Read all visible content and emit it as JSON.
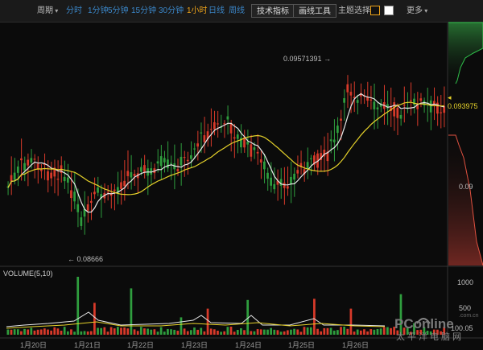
{
  "toolbar": {
    "period_label": "周期",
    "intervals": [
      "分时",
      "1分钟",
      "5分钟",
      "15分钟",
      "30分钟",
      "1小时",
      "日线",
      "周线"
    ],
    "active_interval": "1小时",
    "indicators_button": "技术指标",
    "drawing_button": "画线工具",
    "theme_label": "主题选择",
    "theme_dark_color": "#111111",
    "theme_light_color": "#ffffff",
    "more_label": "更多"
  },
  "chart": {
    "up_color": "#d83a2a",
    "down_color": "#2f9e3e",
    "ma_fast_color": "#e8e8e8",
    "ma_slow_color": "#e6d22a",
    "high_annotation": "0.09571391",
    "low_annotation": "0.08666",
    "current_price": "0.093975",
    "axis_price_0_09": "0.09",
    "volume_title": "VOLUME(5,10)",
    "volume_axis": [
      "1000",
      "500",
      "100.05"
    ],
    "dates": [
      "1月20日",
      "1月21日",
      "1月22日",
      "1月23日",
      "1月24日",
      "1月25日",
      "1月26日"
    ],
    "watermark_text": "PConline",
    "watermark_sub": "太平洋电脑网",
    "watermark_domain": ".com.cn"
  },
  "chart_data": {
    "type": "candlestick",
    "x_labels": [
      "1月20日",
      "1月21日",
      "1月22日",
      "1月23日",
      "1月24日",
      "1月25日",
      "1月26日"
    ],
    "price_high": 0.09571391,
    "price_low": 0.08666,
    "last_price": 0.093975,
    "y_tick": 0.09,
    "volume_ticks": [
      1000,
      500,
      100.05
    ],
    "series": [
      {
        "name": "VOLUME(5,10)"
      }
    ]
  }
}
